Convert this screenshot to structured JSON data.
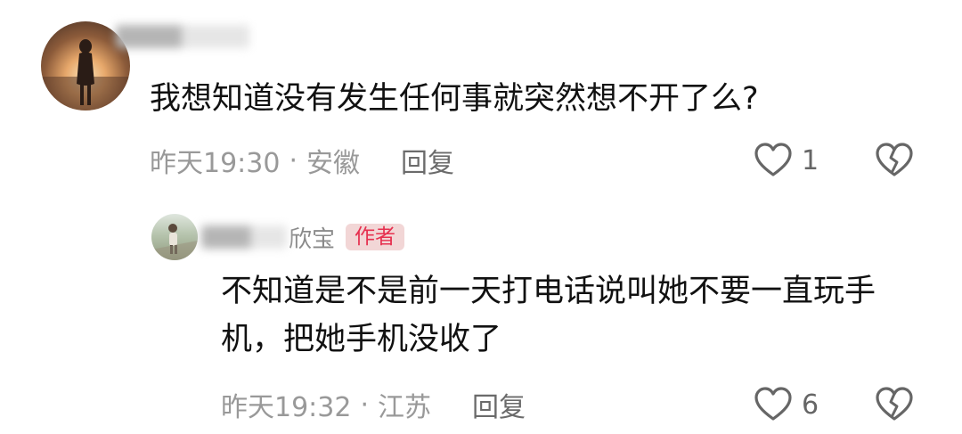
{
  "comments": [
    {
      "username": "████",
      "text": "我想知道没有发生任何事就突然想不开了么?",
      "time": "昨天19:30",
      "separator": "·",
      "location": "安徽",
      "reply_label": "回复",
      "like_count": "1",
      "icons": [
        "avatar",
        "heart-outline-icon",
        "broken-heart-icon"
      ]
    },
    {
      "username_tail": "欣宝",
      "badge": "作者",
      "text": "不知道是不是前一天打电话说叫她不要一直玩手机，把她手机没收了",
      "time": "昨天19:32",
      "separator": "·",
      "location": "江苏",
      "reply_label": "回复",
      "like_count": "6",
      "icons": [
        "avatar",
        "heart-outline-icon",
        "broken-heart-icon"
      ]
    }
  ],
  "colors": {
    "badge_text": "#e6304f",
    "badge_bg": "#f2d6d6",
    "meta_text": "#999999"
  }
}
